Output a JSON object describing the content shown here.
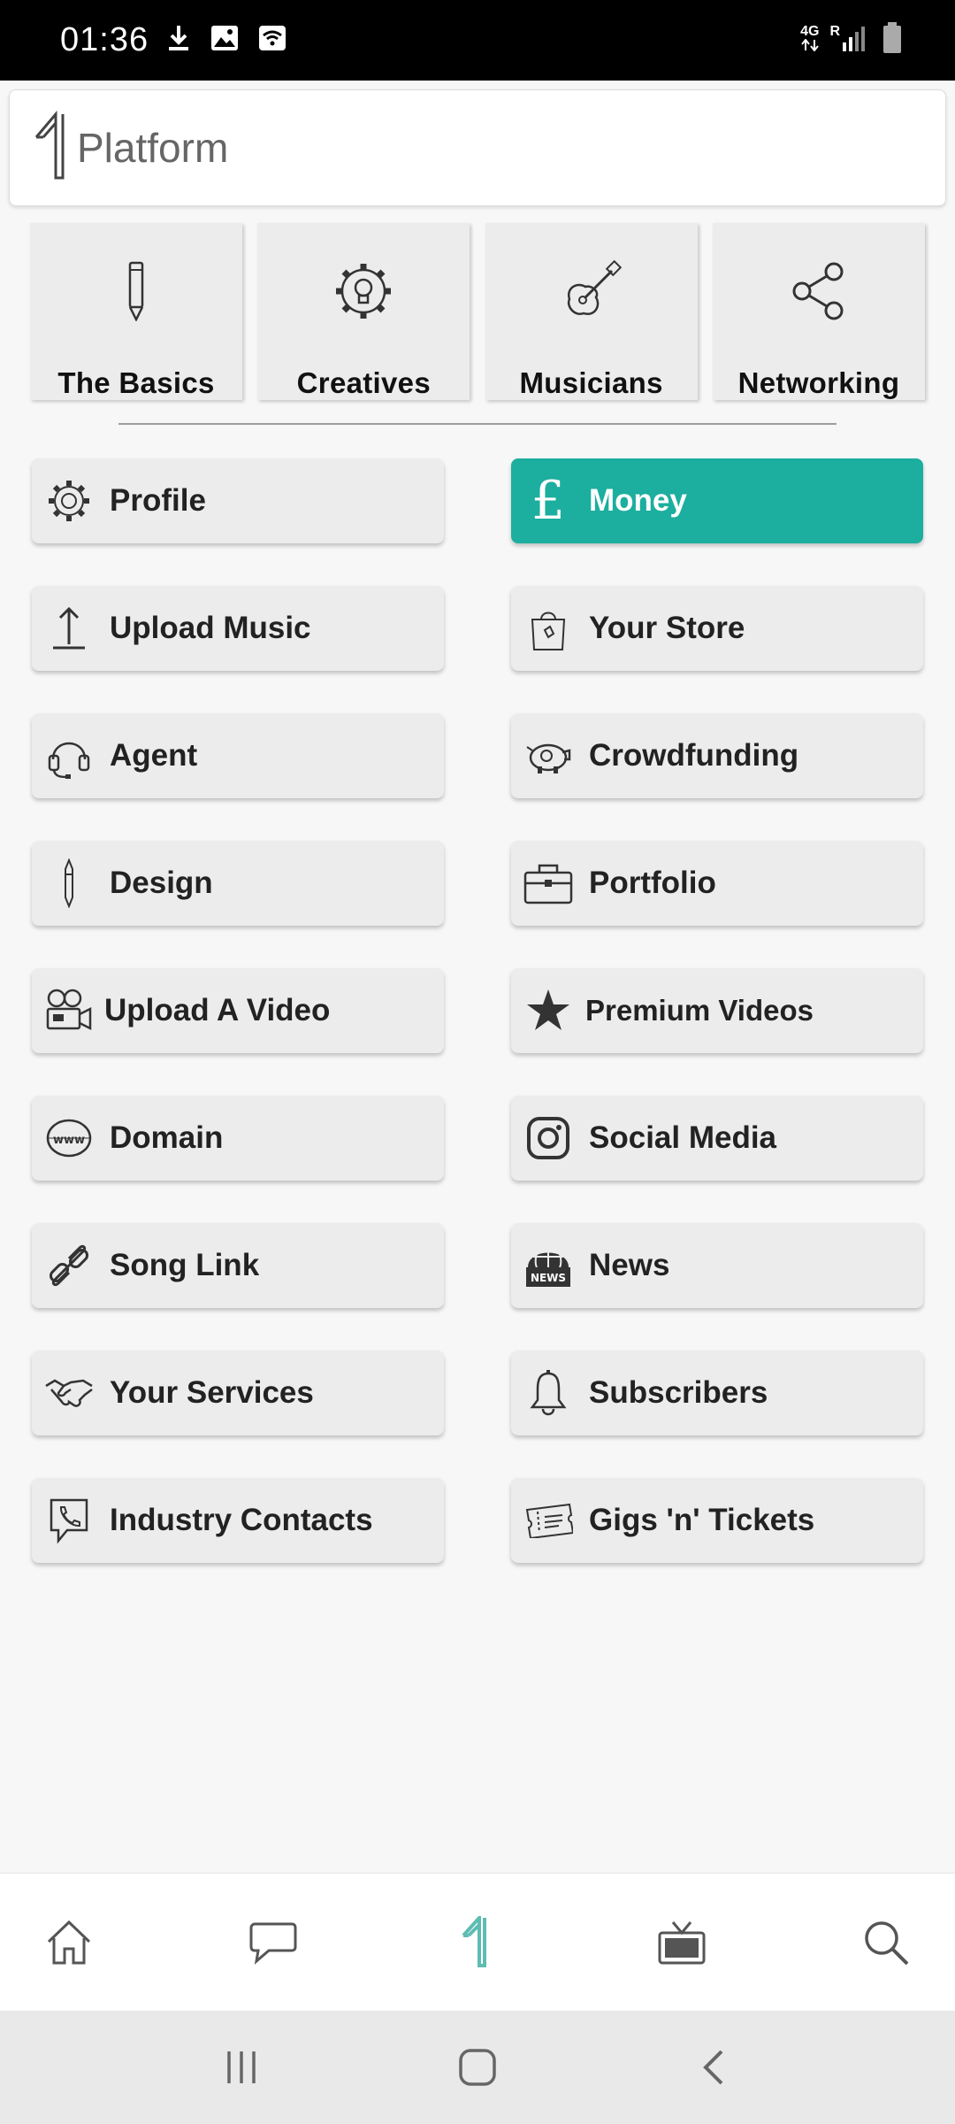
{
  "status_bar": {
    "time": "01:36",
    "network_label": "4G",
    "roaming_label": "R"
  },
  "header": {
    "title": "Platform"
  },
  "categories": [
    {
      "label": "The Basics",
      "icon": "pencil-icon"
    },
    {
      "label": "Creatives",
      "icon": "lightbulb-gear-icon"
    },
    {
      "label": "Musicians",
      "icon": "guitar-icon"
    },
    {
      "label": "Networking",
      "icon": "share-icon"
    }
  ],
  "menu": [
    {
      "label": "Profile",
      "icon": "gear-icon"
    },
    {
      "label": "Money",
      "icon": "pound-icon",
      "active": true
    },
    {
      "label": "Upload Music",
      "icon": "upload-icon"
    },
    {
      "label": "Your Store",
      "icon": "shopping-bag-icon"
    },
    {
      "label": "Agent",
      "icon": "headset-icon"
    },
    {
      "label": "Crowdfunding",
      "icon": "piggy-bank-icon"
    },
    {
      "label": "Design",
      "icon": "pen-icon"
    },
    {
      "label": "Portfolio",
      "icon": "briefcase-icon"
    },
    {
      "label": "Upload A Video",
      "icon": "video-camera-icon"
    },
    {
      "label": "Premium Videos",
      "icon": "star-icon"
    },
    {
      "label": "Domain",
      "icon": "www-icon"
    },
    {
      "label": "Social Media",
      "icon": "instagram-icon"
    },
    {
      "label": "Song Link",
      "icon": "link-icon"
    },
    {
      "label": "News",
      "icon": "news-globe-icon",
      "badge": "NEWS"
    },
    {
      "label": "Your Services",
      "icon": "handshake-icon"
    },
    {
      "label": "Subscribers",
      "icon": "bell-icon"
    },
    {
      "label": "Industry Contacts",
      "icon": "phone-chat-icon"
    },
    {
      "label": "Gigs 'n' Tickets",
      "icon": "ticket-icon"
    }
  ],
  "bottom_nav": [
    "home-icon",
    "chat-icon",
    "platform-logo-icon",
    "tv-icon",
    "search-icon"
  ],
  "colors": {
    "accent": "#1cae9e",
    "status_bar": "#000000",
    "tile": "#ececec"
  }
}
